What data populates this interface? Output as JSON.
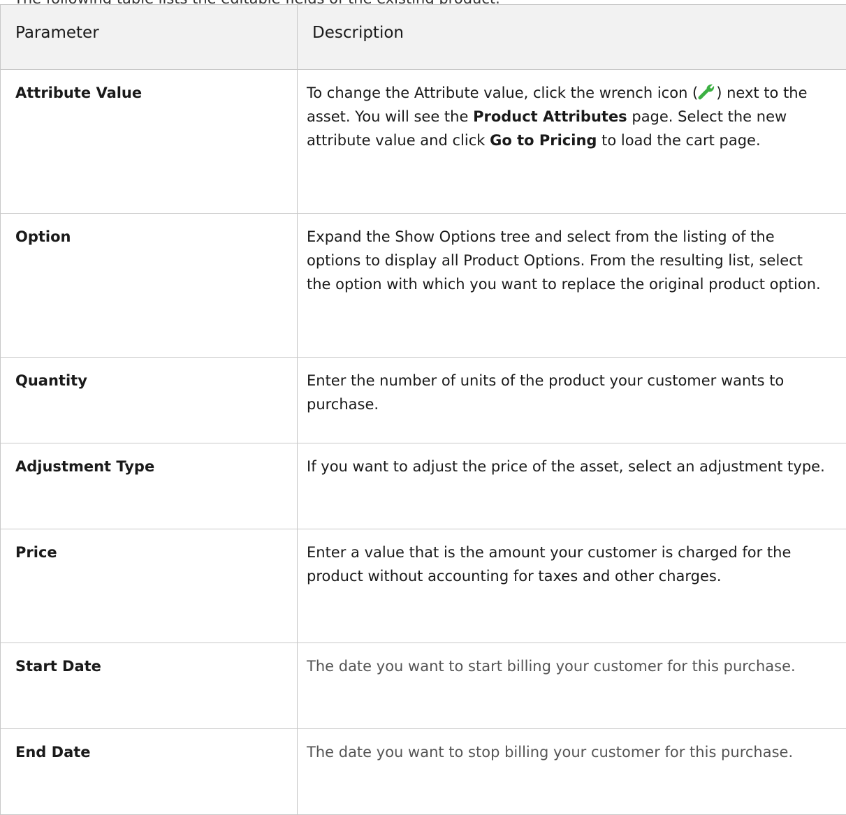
{
  "cut_text": "The following table lists the editable fields of the existing product.",
  "table": {
    "headers": [
      "Parameter",
      "Description"
    ],
    "rows": [
      {
        "param": "Attribute Value",
        "desc_part1": "To change the Attribute value, click the wrench icon (",
        "desc_part2": ") next to the asset. You will see the ",
        "desc_bold1": "Product Attributes",
        "desc_part3": " page. Select the new attribute value and click ",
        "desc_bold2": "Go to Pricing",
        "desc_part4": " to load the cart page."
      },
      {
        "param": "Option",
        "desc": "Expand the Show Options tree and select from the listing of the options to display all Product Options. From the resulting list, select the option with which you want to replace the original product option."
      },
      {
        "param": "Quantity",
        "desc": "Enter the number of units of the product your customer wants to purchase."
      },
      {
        "param": "Adjustment Type",
        "desc": "If you want to adjust the price of the asset, select an adjustment type."
      },
      {
        "param": "Price",
        "desc": "Enter a value that is the amount your customer is charged for the product without accounting for taxes and other charges."
      },
      {
        "param": "Start Date",
        "desc": "The date you want to start billing your customer for this purchase."
      },
      {
        "param": "End Date",
        "desc": "The date you want to stop billing your customer for this purchase."
      }
    ]
  },
  "icons": {
    "wrench": "wrench-icon",
    "wrench_color": "#3cb043"
  }
}
